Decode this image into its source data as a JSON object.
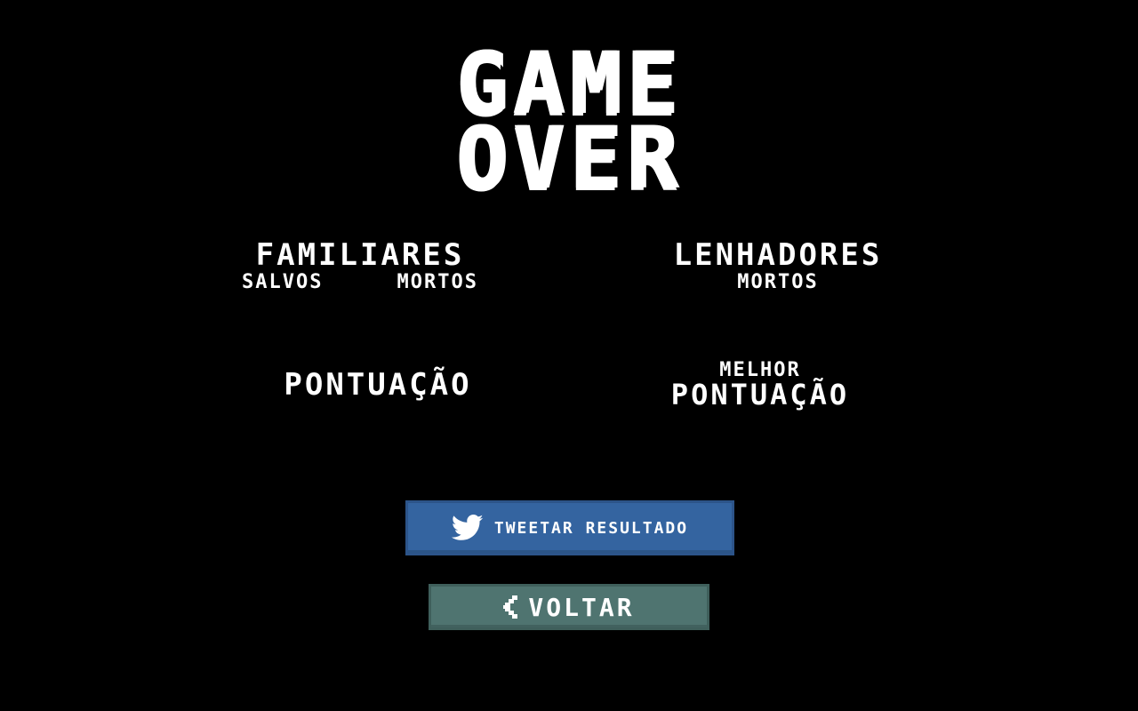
{
  "title": {
    "line1": "GAME",
    "line2": "OVER"
  },
  "stats": {
    "familiares": {
      "title": "FAMILIARES",
      "salvos_label": "SALVOS",
      "mortos_label": "MORTOS"
    },
    "lenhadores": {
      "title": "LENHADORES",
      "mortos_label": "MORTOS"
    },
    "pontuacao": {
      "title": "PONTUAÇÃO"
    },
    "melhor_pontuacao": {
      "line1": "MELHOR",
      "line2": "PONTUAÇÃO"
    }
  },
  "buttons": {
    "tweet": {
      "label": "TWEETAR RESULTADO",
      "icon": "twitter-bird-icon",
      "color": "#3464a0"
    },
    "back": {
      "label": "VOLTAR",
      "icon": "chevron-left-icon",
      "color": "#4f7470"
    }
  },
  "colors": {
    "background": "#000000",
    "text": "#ffffff"
  }
}
